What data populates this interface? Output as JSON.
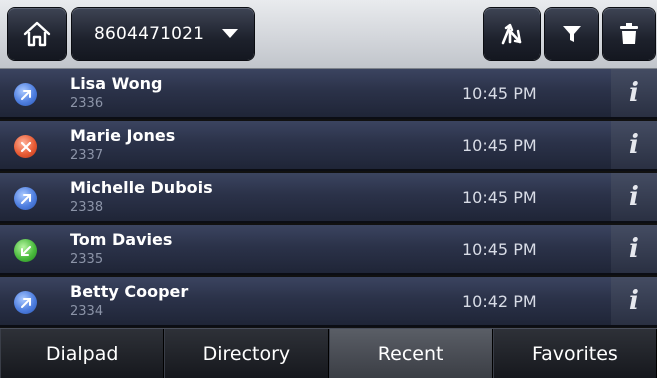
{
  "line_selector": {
    "number": "8604471021"
  },
  "calls": [
    {
      "name": "Lisa Wong",
      "ext": "2336",
      "time": "10:45 PM",
      "type": "outgoing"
    },
    {
      "name": "Marie Jones",
      "ext": "2337",
      "time": "10:45 PM",
      "type": "missed"
    },
    {
      "name": "Michelle Dubois",
      "ext": "2338",
      "time": "10:45 PM",
      "type": "outgoing"
    },
    {
      "name": "Tom Davies",
      "ext": "2335",
      "time": "10:45 PM",
      "type": "received"
    },
    {
      "name": "Betty Cooper",
      "ext": "2334",
      "time": "10:42 PM",
      "type": "outgoing"
    }
  ],
  "info_glyph": "i",
  "tabs": [
    {
      "label": "Dialpad",
      "active": false
    },
    {
      "label": "Directory",
      "active": false
    },
    {
      "label": "Recent",
      "active": true
    },
    {
      "label": "Favorites",
      "active": false
    }
  ],
  "icons": {
    "home": "home-icon",
    "sort": "sort-arrows-icon",
    "filter": "filter-icon",
    "delete": "trash-icon",
    "outgoing": "outgoing-call-icon",
    "missed": "missed-call-icon",
    "received": "received-call-icon"
  },
  "colors": {
    "outgoing": "#4f7fe0",
    "missed": "#e85c35",
    "received": "#4bbb3e",
    "active_tab": "#4a4e56"
  }
}
